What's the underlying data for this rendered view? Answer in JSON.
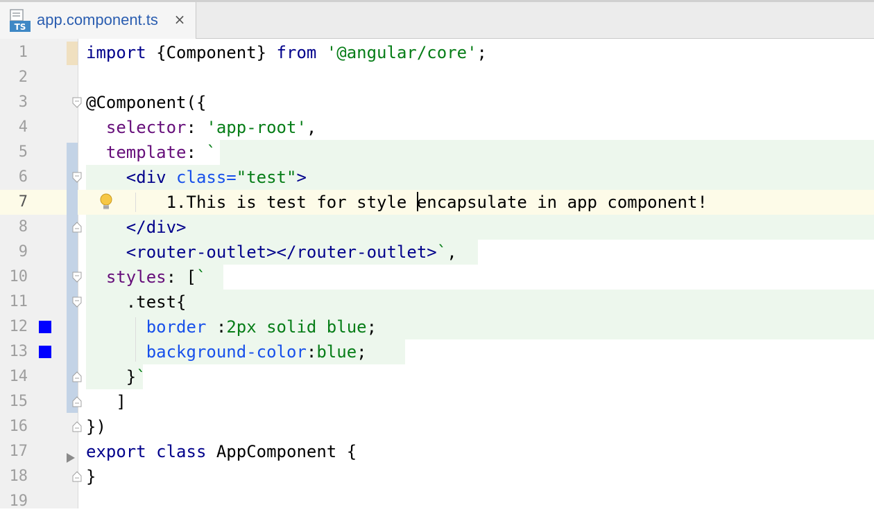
{
  "tab": {
    "label": "app.component.ts",
    "close_label": "×",
    "icon": "typescript-file-icon",
    "icon_text": "TS"
  },
  "colors": {
    "keyword": "#00008b",
    "string": "#067d17",
    "property": "#660e7a",
    "color_marker": "#0000ff",
    "injected_bg": "#edf7ed",
    "current_line_bg": "#fdfbe8",
    "change_marker": "#c3d3e6"
  },
  "editor": {
    "current_line": 7,
    "lines": [
      {
        "n": "1",
        "parts": [
          [
            "kw",
            "import "
          ],
          [
            "",
            "{Component} "
          ],
          [
            "kw",
            "from "
          ],
          [
            "str",
            "'@angular/core'"
          ],
          [
            "",
            ";"
          ]
        ]
      },
      {
        "n": "2",
        "parts": []
      },
      {
        "n": "3",
        "parts": [
          [
            "",
            "@Component({"
          ]
        ]
      },
      {
        "n": "4",
        "parts": [
          [
            "",
            "  "
          ],
          [
            "prop",
            "selector"
          ],
          [
            "",
            ": "
          ],
          [
            "str",
            "'app-root'"
          ],
          [
            "",
            ","
          ]
        ]
      },
      {
        "n": "5",
        "parts": [
          [
            "",
            "  "
          ],
          [
            "prop",
            "template"
          ],
          [
            "",
            ": "
          ],
          [
            "str",
            "`"
          ]
        ]
      },
      {
        "n": "6",
        "parts": [
          [
            "",
            "    "
          ],
          [
            "tag",
            "<div "
          ],
          [
            "attr",
            "class="
          ],
          [
            "str",
            "\"test\""
          ],
          [
            "tag",
            ">"
          ]
        ]
      },
      {
        "n": "7",
        "parts": [
          [
            "",
            "        1.This is test for style "
          ],
          [
            "caret",
            ""
          ],
          [
            "",
            "encapsulate in app component!"
          ]
        ]
      },
      {
        "n": "8",
        "parts": [
          [
            "",
            "    "
          ],
          [
            "tag",
            "</div>"
          ]
        ]
      },
      {
        "n": "9",
        "parts": [
          [
            "",
            "    "
          ],
          [
            "tag",
            "<router-outlet></router-outlet>"
          ],
          [
            "str",
            "`"
          ],
          [
            "",
            ","
          ]
        ]
      },
      {
        "n": "10",
        "parts": [
          [
            "",
            "  "
          ],
          [
            "prop",
            "styles"
          ],
          [
            "",
            ": ["
          ],
          [
            "str",
            "`"
          ]
        ]
      },
      {
        "n": "11",
        "parts": [
          [
            "",
            "    "
          ],
          [
            "",
            "."
          ],
          [
            "",
            "test{"
          ]
        ]
      },
      {
        "n": "12",
        "parts": [
          [
            "",
            "      "
          ],
          [
            "cssp",
            "border "
          ],
          [
            "",
            ":"
          ],
          [
            "cssv",
            "2px solid blue"
          ],
          [
            "",
            ";"
          ]
        ]
      },
      {
        "n": "13",
        "parts": [
          [
            "",
            "      "
          ],
          [
            "cssp",
            "background-color"
          ],
          [
            "",
            ":"
          ],
          [
            "cssv",
            "blue"
          ],
          [
            "",
            ";"
          ]
        ]
      },
      {
        "n": "14",
        "parts": [
          [
            "",
            "    "
          ],
          [
            "",
            "}"
          ],
          [
            "str",
            "`"
          ]
        ]
      },
      {
        "n": "15",
        "parts": [
          [
            "",
            "   ]"
          ]
        ]
      },
      {
        "n": "16",
        "parts": [
          [
            "",
            "})"
          ]
        ]
      },
      {
        "n": "17",
        "parts": [
          [
            "kw",
            "export "
          ],
          [
            "kw",
            "class "
          ],
          [
            "",
            "AppComponent {"
          ]
        ]
      },
      {
        "n": "18",
        "parts": [
          [
            "",
            "}"
          ]
        ]
      },
      {
        "n": "19",
        "parts": []
      }
    ]
  },
  "gutter_icons": {
    "bulb": "lightbulb-icon",
    "color_swatch": "color-swatch-icon",
    "fold": "fold-icon",
    "arrow": "run-arrow-icon"
  }
}
